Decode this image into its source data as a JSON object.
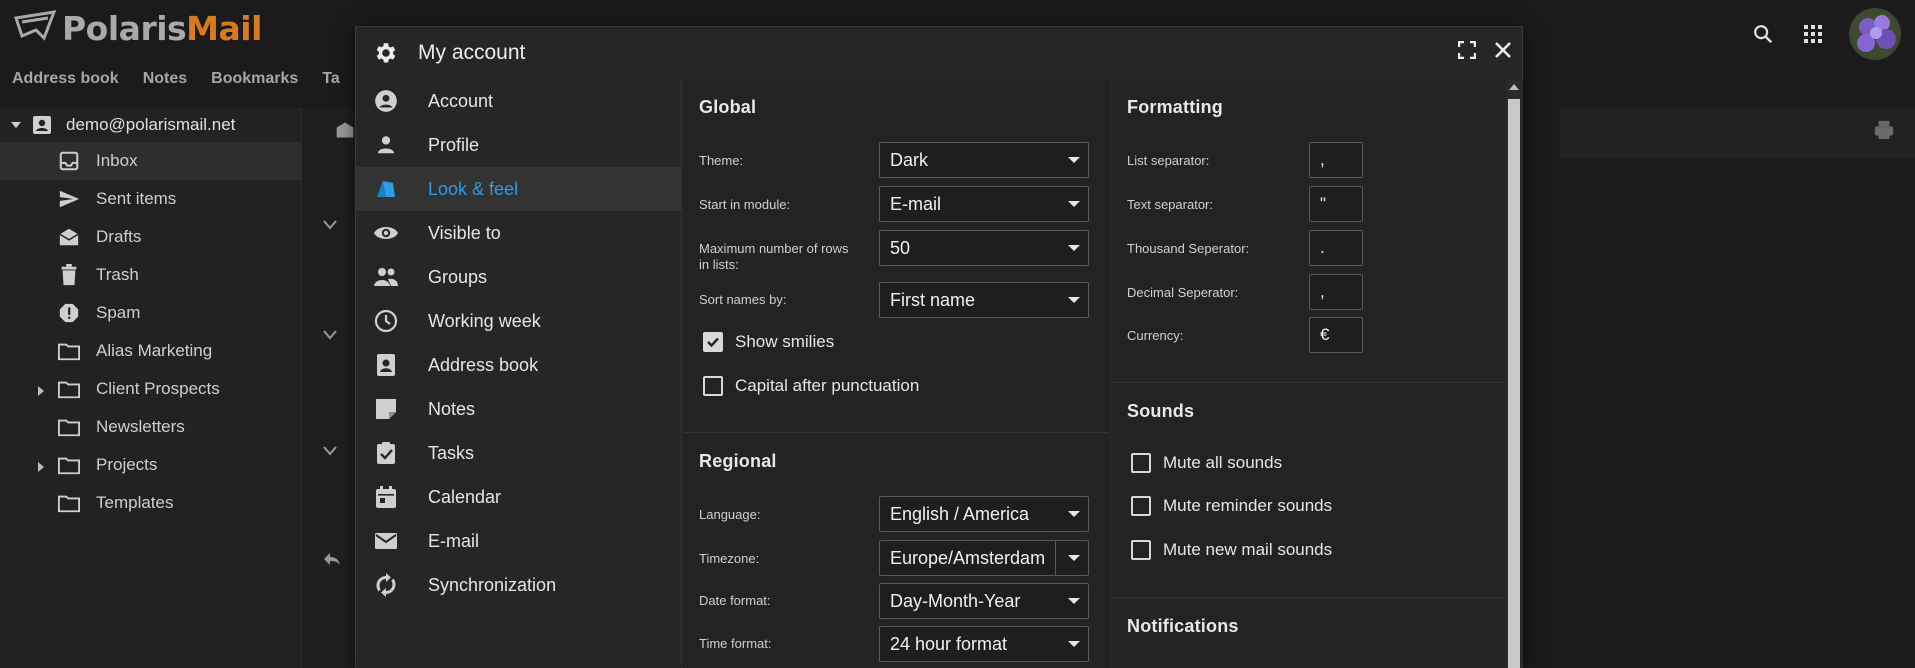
{
  "app": {
    "logo": {
      "part1": "Polaris",
      "part2": "Mail"
    },
    "nav_tabs": [
      "Address book",
      "Notes",
      "Bookmarks",
      "Ta"
    ]
  },
  "sidebar": {
    "account": "demo@polarismail.net",
    "folders": [
      {
        "label": "Inbox",
        "icon": "inbox-icon",
        "active": true
      },
      {
        "label": "Sent items",
        "icon": "send-icon"
      },
      {
        "label": "Drafts",
        "icon": "drafts-icon"
      },
      {
        "label": "Trash",
        "icon": "trash-icon"
      },
      {
        "label": "Spam",
        "icon": "spam-icon"
      },
      {
        "label": "Alias Marketing",
        "icon": "folder-icon"
      },
      {
        "label": "Client Prospects",
        "icon": "folder-icon",
        "expandable": true
      },
      {
        "label": "Newsletters",
        "icon": "folder-icon"
      },
      {
        "label": "Projects",
        "icon": "folder-icon",
        "expandable": true
      },
      {
        "label": "Templates",
        "icon": "folder-icon"
      }
    ]
  },
  "dialog": {
    "title": "My account",
    "menu": [
      {
        "label": "Account",
        "icon": "account-circle-icon"
      },
      {
        "label": "Profile",
        "icon": "person-icon"
      },
      {
        "label": "Look & feel",
        "icon": "paint-icon",
        "active": true
      },
      {
        "label": "Visible to",
        "icon": "eye-icon"
      },
      {
        "label": "Groups",
        "icon": "groups-icon"
      },
      {
        "label": "Working week",
        "icon": "clock-icon"
      },
      {
        "label": "Address book",
        "icon": "contacts-icon"
      },
      {
        "label": "Notes",
        "icon": "note-icon"
      },
      {
        "label": "Tasks",
        "icon": "tasks-icon"
      },
      {
        "label": "Calendar",
        "icon": "calendar-icon"
      },
      {
        "label": "E-mail",
        "icon": "mail-icon"
      },
      {
        "label": "Synchronization",
        "icon": "sync-icon"
      }
    ],
    "global": {
      "title": "Global",
      "theme_label": "Theme:",
      "theme_value": "Dark",
      "start_label": "Start in module:",
      "start_value": "E-mail",
      "rows_label_1": "Maximum number of rows",
      "rows_label_2": "in lists:",
      "rows_value": "50",
      "sort_label": "Sort names by:",
      "sort_value": "First name",
      "smilies_label": "Show smilies",
      "capital_label": "Capital after punctuation"
    },
    "regional": {
      "title": "Regional",
      "language_label": "Language:",
      "language_value": "English / America",
      "timezone_label": "Timezone:",
      "timezone_value": "Europe/Amsterdam",
      "date_label": "Date format:",
      "date_value": "Day-Month-Year",
      "time_label": "Time format:",
      "time_value": "24 hour format"
    },
    "formatting": {
      "title": "Formatting",
      "list_sep_label": "List separator:",
      "list_sep_value": ",",
      "text_sep_label": "Text separator:",
      "text_sep_value": "\"",
      "thousand_label": "Thousand Seperator:",
      "thousand_value": ".",
      "decimal_label": "Decimal Seperator:",
      "decimal_value": ",",
      "currency_label": "Currency:",
      "currency_value": "€"
    },
    "sounds": {
      "title": "Sounds",
      "mute_all": "Mute all sounds",
      "mute_reminder": "Mute reminder sounds",
      "mute_mail": "Mute new mail sounds"
    },
    "notifications": {
      "title": "Notifications"
    }
  },
  "colors": {
    "accent": "#2b9de6",
    "brand_orange": "#d77a24"
  }
}
